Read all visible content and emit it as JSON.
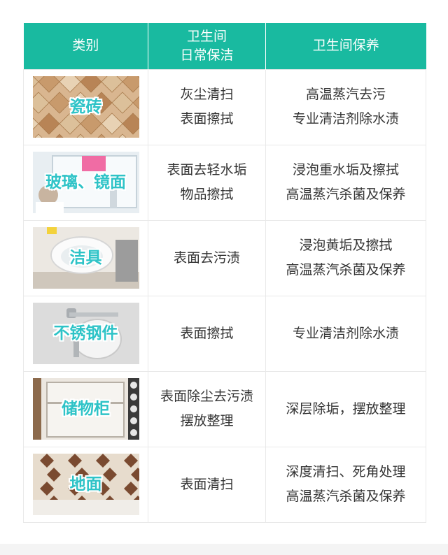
{
  "chart_data": {
    "type": "table",
    "columns": [
      "类别",
      "卫生间|日常保洁",
      "卫生间保养"
    ],
    "rows": [
      {
        "category": "瓷砖",
        "image": "tile-photo",
        "daily": [
          "灰尘清扫",
          "表面擦拭"
        ],
        "maintenance": [
          "高温蒸汽去污",
          "专业清洁剂除水渍"
        ]
      },
      {
        "category": "玻璃、镜面",
        "image": "glass-mirror-photo",
        "daily": [
          "表面去轻水垢",
          "物品擦拭"
        ],
        "maintenance": [
          "浸泡重水垢及擦拭",
          "高温蒸汽杀菌及保养"
        ]
      },
      {
        "category": "洁具",
        "image": "toilet-photo",
        "daily": [
          "表面去污渍"
        ],
        "maintenance": [
          "浸泡黄垢及擦拭",
          "高温蒸汽杀菌及保养"
        ]
      },
      {
        "category": "不锈钢件",
        "image": "steel-fitting-photo",
        "daily": [
          "表面擦拭"
        ],
        "maintenance": [
          "专业清洁剂除水渍"
        ]
      },
      {
        "category": "储物柜",
        "image": "cabinet-photo",
        "daily": [
          "表面除尘去污渍",
          "摆放整理"
        ],
        "maintenance": [
          "深层除垢，摆放整理"
        ]
      },
      {
        "category": "地面",
        "image": "floor-photo",
        "daily": [
          "表面清扫"
        ],
        "maintenance": [
          "深度清扫、死角处理",
          "高温蒸汽杀菌及保养"
        ]
      }
    ]
  },
  "colors": {
    "header_bg": "#19baa0",
    "label_teal": "#2ec3c7",
    "border": "#e9e9e9",
    "text": "#333333"
  }
}
